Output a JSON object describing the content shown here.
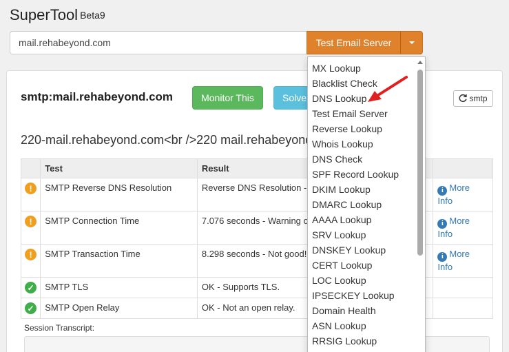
{
  "app": {
    "name": "SuperTool",
    "version": "Beta9"
  },
  "search": {
    "value": "mail.rehabeyond.com"
  },
  "test_button": {
    "label": "Test Email Server"
  },
  "panel": {
    "title": "smtp:mail.rehabeyond.com",
    "monitor_label": "Monitor This",
    "solve_label": "Solve",
    "refresh_label": "smtp",
    "banner": "220-mail.rehabeyond.com<br />220 mail.rehabeyond.com"
  },
  "table": {
    "headers": {
      "test": "Test",
      "result": "Result"
    },
    "rows": [
      {
        "status": "warning",
        "test": "SMTP Reverse DNS Resolution",
        "result": "Reverse DNS Resolution - Warning",
        "more": "More",
        "info": "Info"
      },
      {
        "status": "warning",
        "test": "SMTP Connection Time",
        "result": "7.076 seconds - Warning on",
        "more": "More",
        "info": "Info"
      },
      {
        "status": "warning",
        "test": "SMTP Transaction Time",
        "result": "8.298 seconds - Not good! on",
        "more": "More",
        "info": "Info"
      },
      {
        "status": "ok",
        "test": "SMTP TLS",
        "result": "OK - Supports TLS.",
        "more": "",
        "info": ""
      },
      {
        "status": "ok",
        "test": "SMTP Open Relay",
        "result": "OK - Not an open relay.",
        "more": "",
        "info": ""
      }
    ]
  },
  "transcript": {
    "label": "Session Transcript:"
  },
  "dropdown": {
    "items": [
      "MX Lookup",
      "Blacklist Check",
      "DNS Lookup",
      "Test Email Server",
      "Reverse Lookup",
      "Whois Lookup",
      "DNS Check",
      "SPF Record Lookup",
      "DKIM Lookup",
      "DMARC Lookup",
      "AAAA Lookup",
      "SRV Lookup",
      "DNSKEY Lookup",
      "CERT Lookup",
      "LOC Lookup",
      "IPSECKEY Lookup",
      "Domain Health",
      "ASN Lookup",
      "RRSIG Lookup"
    ]
  },
  "colors": {
    "accent": "#e0822b",
    "success": "#5cb85c",
    "info": "#5bc0de",
    "warning": "#f0a020",
    "annotation_arrow": "#e02020"
  },
  "icons": {
    "warning": "warning-circle-icon",
    "ok": "check-circle-icon",
    "info": "info-circle-icon",
    "refresh": "refresh-icon",
    "caret": "caret-down-icon"
  }
}
